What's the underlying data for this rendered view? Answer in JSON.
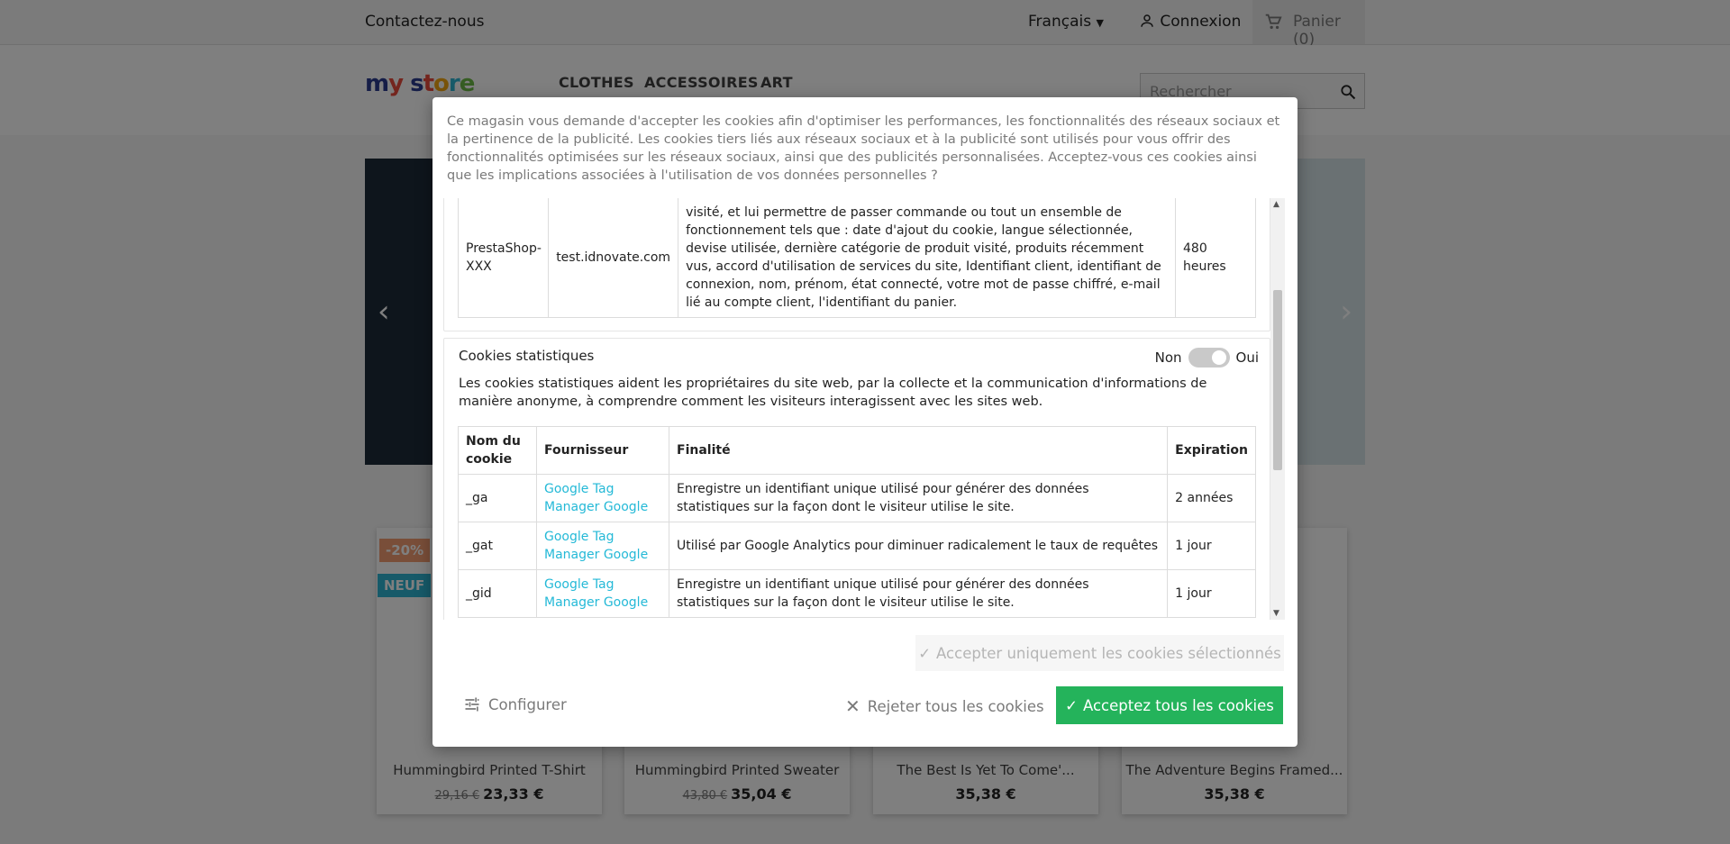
{
  "topbar": {
    "contact": "Contactez-nous",
    "language": "Français",
    "login": "Connexion",
    "cart": "Panier (0)"
  },
  "header": {
    "logo_letters": [
      "m",
      "y",
      " ",
      "s",
      "t",
      "o",
      "r",
      "e"
    ],
    "nav": [
      "CLOTHES",
      "ACCESSOIRES",
      "ART"
    ],
    "search_placeholder": "Rechercher"
  },
  "badges": {
    "discount": "-20%",
    "new": "NEUF"
  },
  "products": [
    {
      "name": "Hummingbird Printed T-Shirt",
      "old_price": "29,16 €",
      "price": "23,33 €"
    },
    {
      "name": "Hummingbird Printed Sweater",
      "old_price": "43,80 €",
      "price": "35,04 €"
    },
    {
      "name": "The Best Is Yet To Come'...",
      "old_price": "",
      "price": "35,38 €"
    },
    {
      "name": "The Adventure Begins Framed...",
      "old_price": "",
      "price": "35,38 €"
    }
  ],
  "modal": {
    "intro": "Ce magasin vous demande d'accepter les cookies afin d'optimiser les performances, les fonctionnalités des réseaux sociaux et la pertinence de la publicité. Les cookies tiers liés aux réseaux sociaux et à la publicité sont utilisés pour vous offrir des fonctionnalités optimisées sur les réseaux sociaux, ainsi que des publicités personnalisées. Acceptez-vous ces cookies ainsi que les implications associées à l'utilisation de vos données personnelles ?",
    "functional_row": {
      "name": "PrestaShop-XXX",
      "provider": "test.idnovate.com",
      "purpose_partial": "visité, et lui permettre de passer commande ou tout un ensemble de fonctionnement tels que : date d'ajout du cookie, langue sélectionnée, devise utilisée, dernière catégorie de produit visité, produits récemment vus, accord d'utilisation de services du site, Identifiant client, identifiant de connexion, nom, prénom, état connecté, votre mot de passe chiffré, e-mail lié au compte client, l'identifiant du panier.",
      "expiration": "480 heures"
    },
    "statistics": {
      "title": "Cookies statistiques",
      "toggle_off": "Non",
      "toggle_on": "Oui",
      "description": "Les cookies statistiques aident les propriétaires du site web, par la collecte et la communication d'informations de manière anonyme, à comprendre comment les visiteurs interagissent avec les sites web.",
      "headers": [
        "Nom du cookie",
        "Fournisseur",
        "Finalité",
        "Expiration"
      ],
      "rows": [
        {
          "name": "_ga",
          "provider": "Google Tag Manager Google",
          "purpose": "Enregistre un identifiant unique utilisé pour générer des données statistiques sur la façon dont le visiteur utilise le site.",
          "expiration": "2 années"
        },
        {
          "name": "_gat",
          "provider": "Google Tag Manager Google",
          "purpose": "Utilisé par Google Analytics pour diminuer radicalement le taux de requêtes",
          "expiration": "1 jour"
        },
        {
          "name": "_gid",
          "provider": "Google Tag Manager Google",
          "purpose": "Enregistre un identifiant unique utilisé pour générer des données statistiques sur la façon dont le visiteur utilise le site.",
          "expiration": "1 jour"
        }
      ]
    },
    "buttons": {
      "accept_selected": "Accepter uniquement les cookies sélectionnés",
      "configure": "Configurer",
      "reject_all": "Rejeter tous les cookies",
      "accept_all": "Acceptez tous les cookies"
    }
  },
  "colors": {
    "accept": "#24b35b",
    "link": "#24b9d7",
    "discount_badge": "#f39d72",
    "new_badge": "#2fb5d2"
  }
}
